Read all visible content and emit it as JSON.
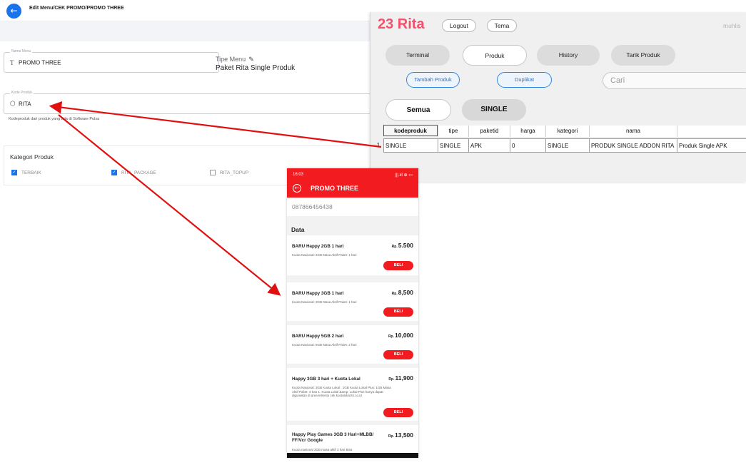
{
  "admin": {
    "title": "Edit Menu/CEK PROMO/PROMO THREE",
    "nama_menu": {
      "label": "Nama Menu",
      "value": "PROMO THREE"
    },
    "tipe_menu": {
      "label": "Tipe Menu",
      "value": "Paket Rita Single Produk"
    },
    "kode_produk": {
      "label": "Kode Produk",
      "value": "RITA",
      "helper": "Kodeproduk dari produk yang ada di Software Pulsa"
    },
    "kategori": {
      "title": "Kategori Produk",
      "items": [
        {
          "label": "TERBAIK",
          "checked": true
        },
        {
          "label": "RITA_PACKAGE",
          "checked": true
        },
        {
          "label": "RITA_TOPUP",
          "checked": false
        }
      ]
    }
  },
  "desktop": {
    "brand": "23 Rita",
    "logout": "Logout",
    "tema": "Tema",
    "user": "muhlis",
    "nav": [
      "Terminal",
      "Produk",
      "History",
      "Tarik Produk"
    ],
    "tambah": "Tambah Produk",
    "duplikat": "Duplikat",
    "search_placeholder": "Cari",
    "filters": [
      "Semua",
      "SINGLE"
    ],
    "table": {
      "headers": [
        "kodeproduk",
        "tipe",
        "paketid",
        "harga",
        "kategori",
        "nama",
        ""
      ],
      "rows": [
        {
          "index": "1",
          "cells": [
            "SINGLE",
            "SINGLE",
            "APK",
            "0",
            "SINGLE",
            "PRODUK SINGLE ADDON RITA",
            "Produk Single APK"
          ]
        }
      ]
    }
  },
  "phone": {
    "time": "16:03",
    "status_right": "|||.ıll ⊕ ▭",
    "title": "PROMO THREE",
    "number": "087866456438",
    "section": "Data",
    "buy_label": "BELI",
    "currency": "Rp.",
    "products": [
      {
        "name": "BARU Happy 2GB 1 hari",
        "price": "5.500",
        "desc": "Kuota Nasional: 2GB Masa Aktif Paket: 1 hari"
      },
      {
        "name": "BARU Happy 3GB 1 hari",
        "price": "8,500",
        "desc": "Kuota Nasional: 3GB Masa Aktif Paket: 1 hari"
      },
      {
        "name": "BARU Happy 5GB 2 hari",
        "price": "10,000",
        "desc": "Kuota Nasional: 5GB Masa Aktif Paket: 2 hari"
      },
      {
        "name": "Happy 3GB 3 hari + Kuota Lokal",
        "price": "11,900",
        "desc": "Kuota Nasional: 3GB Kuota Lokal : 1GB Kuota Lokal Plus: 1GB Masa Aktif Paket: 3 hari 1. Kuota Lokal &amp; Lokal Plus hanya dapat digunakan di area tertentu cek kuotalokal.tri.co.id"
      },
      {
        "name": "Happy Play Games 3GB 3 Hari+MLBB/ FF/Vcr Google",
        "price": "13,500",
        "desc": "Kuota nasional 3GB masa aktif 3 hari Bisa"
      }
    ]
  },
  "colors": {
    "accent_red": "#f21b1f",
    "brand_pink": "#f4506b",
    "admin_blue": "#1a73e8",
    "arrow_red": "#e01010"
  }
}
